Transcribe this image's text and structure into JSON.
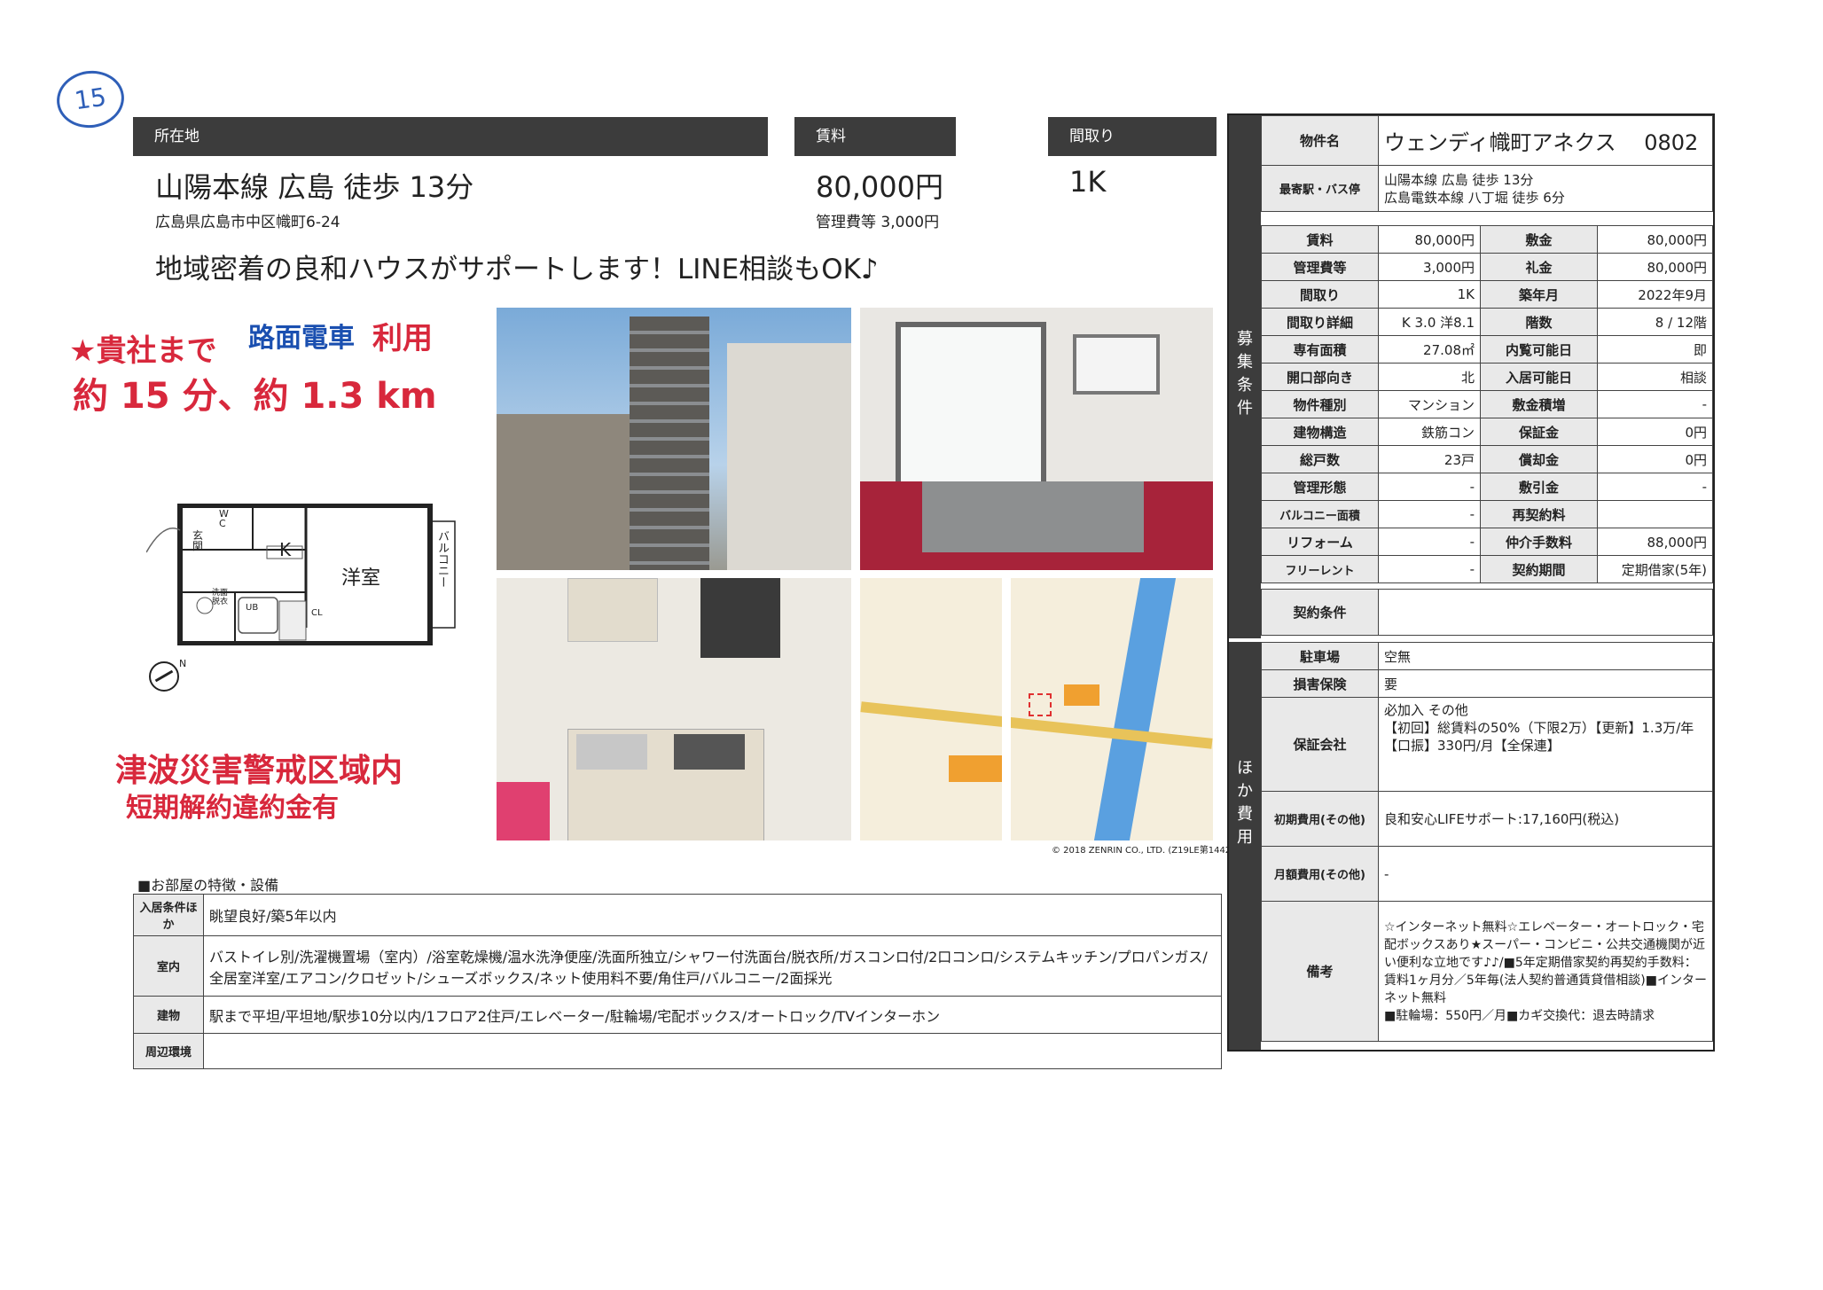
{
  "page_number_mark": "15",
  "location": {
    "header": "所在地",
    "station": "山陽本線 広島 徒歩 13分",
    "address": "広島県広島市中区幟町6-24"
  },
  "rent": {
    "header": "賃料",
    "value": "80,000円",
    "mgmt": "管理費等 3,000円"
  },
  "layout": {
    "header": "間取り",
    "value": "1K"
  },
  "catchcopy": "地域密着の良和ハウスがサポートします！LINE相談もOK♪",
  "handwritten": {
    "line1": "★貴社まで",
    "line1b": "路面電車",
    "line1c": "利用",
    "line2": "約 15 分、約 1.3 km"
  },
  "warning": {
    "line1": "津波災害警戒区域内",
    "line2": "短期解約違約金有"
  },
  "floorplan": {
    "wc": "W\nC",
    "kan": "玄\n関",
    "k": "K",
    "youshitsu": "洋室",
    "balcony": "バルコニー",
    "ub": "UB",
    "cl": "CL",
    "sen": "洗面\n脱衣",
    "compass": "N"
  },
  "map_credit": "© 2018 ZENRIN CO., LTD. (Z19LE第1442号)",
  "features": {
    "title": "■お部屋の特徴・設備",
    "rows": [
      {
        "label": "入居条件ほか",
        "value": "眺望良好/築5年以内"
      },
      {
        "label": "室内",
        "value": "バストイレ別/洗濯機置場（室内）/浴室乾燥機/温水洗浄便座/洗面所独立/シャワー付洗面台/脱衣所/ガスコンロ付/2口コンロ/システムキッチン/プロパンガス/全居室洋室/エアコン/クロゼット/シューズボックス/ネット使用料不要/角住戸/バルコニー/2面採光"
      },
      {
        "label": "建物",
        "value": "駅まで平坦/平坦地/駅歩10分以内/1フロア2住戸/エレベーター/駐輪場/宅配ボックス/オートロック/TVインターホン"
      },
      {
        "label": "周辺環境",
        "value": ""
      }
    ]
  },
  "property": {
    "name_label": "物件名",
    "name": "ウェンディ幟町アネクス　 0802",
    "station_label": "最寄駅・バス停",
    "station1": "山陽本線 広島 徒歩 13分",
    "station2": "広島電鉄本線 八丁堀 徒歩 6分"
  },
  "side_labels": {
    "boshu": "募\n集\n条\n件",
    "hoka": "ほ\nか\n費\n用"
  },
  "spec": [
    [
      "賃料",
      "80,000円",
      "敷金",
      "80,000円"
    ],
    [
      "管理費等",
      "3,000円",
      "礼金",
      "80,000円"
    ],
    [
      "間取り",
      "1K",
      "築年月",
      "2022年9月"
    ],
    [
      "間取り詳細",
      "K 3.0 洋8.1",
      "階数",
      "8 / 12階"
    ],
    [
      "専有面積",
      "27.08㎡",
      "内覧可能日",
      "即"
    ],
    [
      "開口部向き",
      "北",
      "入居可能日",
      "相談"
    ],
    [
      "物件種別",
      "マンション",
      "敷金積増",
      "-"
    ],
    [
      "建物構造",
      "鉄筋コン",
      "保証金",
      "0円"
    ],
    [
      "総戸数",
      "23戸",
      "償却金",
      "0円"
    ],
    [
      "管理形態",
      "-",
      "敷引金",
      "-"
    ],
    [
      "バルコニー面積",
      "-",
      "再契約料",
      ""
    ],
    [
      "リフォーム",
      "-",
      "仲介手数料",
      "88,000円"
    ],
    [
      "フリーレント",
      "-",
      "契約期間",
      "定期借家(5年)"
    ]
  ],
  "contract_label": "契約条件",
  "costs": {
    "parking_label": "駐車場",
    "parking": "空無",
    "insurance_label": "損害保険",
    "insurance": "要",
    "guarantor_label": "保証会社",
    "guarantor": "必加入 その他\n【初回】総賃料の50%（下限2万）【更新】1.3万/年【口振】330円/月【全保連】",
    "initial_label": "初期費用(その他)",
    "initial": "良和安心LIFEサポート:17,160円(税込)",
    "monthly_label": "月額費用(その他)",
    "monthly": "-",
    "remarks_label": "備考",
    "remarks": "☆インターネット無料☆エレベーター・オートロック・宅配ボックスあり★スーパー・コンビニ・公共交通機関が近い便利な立地です♪♪/■5年定期借家契約再契約手数料：賃料1ヶ月分／5年毎(法人契約普通賃貸借相談)■インターネット無料\n■駐輪場：550円／月■カギ交換代：退去時請求"
  },
  "colors": {
    "header_bg": "#3c3c3c",
    "hand_red": "#d8283c",
    "hand_blue": "#1a4fb0"
  }
}
